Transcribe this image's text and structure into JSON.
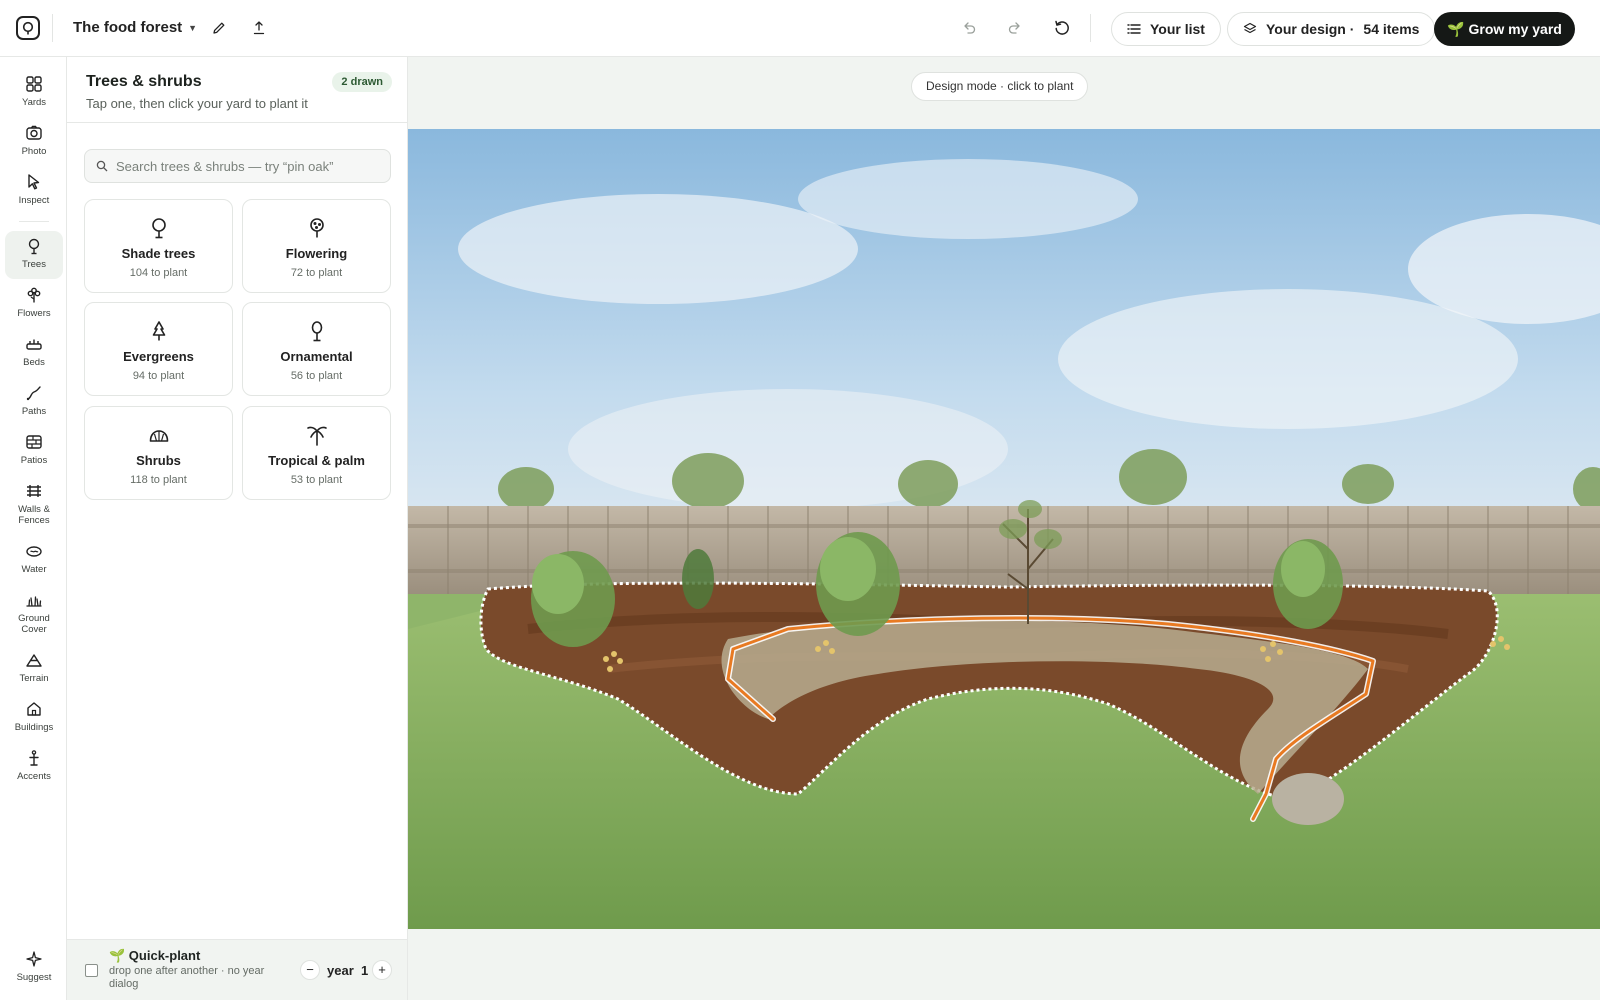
{
  "project": {
    "name": "The food forest"
  },
  "toolbar": {
    "your_list": "Your list",
    "your_design": "Your design ·",
    "design_count": "54 items",
    "grow": "🌱 Grow my yard"
  },
  "rail": {
    "items": [
      {
        "label": "Yards",
        "icon": "grid-icon"
      },
      {
        "label": "Photo",
        "icon": "camera-icon"
      },
      {
        "label": "Inspect",
        "icon": "cursor-icon"
      },
      {
        "label": "Trees",
        "icon": "tree-icon"
      },
      {
        "label": "Flowers",
        "icon": "flower-icon"
      },
      {
        "label": "Beds",
        "icon": "bed-icon"
      },
      {
        "label": "Paths",
        "icon": "path-icon"
      },
      {
        "label": "Patios",
        "icon": "patio-icon"
      },
      {
        "label": "Walls & Fences",
        "icon": "fence-icon"
      },
      {
        "label": "Water",
        "icon": "water-icon"
      },
      {
        "label": "Ground Cover",
        "icon": "grass-icon"
      },
      {
        "label": "Terrain",
        "icon": "terrain-icon"
      },
      {
        "label": "Buildings",
        "icon": "house-icon"
      },
      {
        "label": "Accents",
        "icon": "accent-icon"
      }
    ],
    "suggest": "Suggest"
  },
  "panel": {
    "title": "Trees & shrubs",
    "subtitle": "Tap one, then click your yard to plant it",
    "badge": "2 drawn",
    "search_placeholder": "Search trees & shrubs — try “pin oak”",
    "categories": [
      {
        "name": "Shade trees",
        "count": "104 to plant",
        "icon": "shade-tree-icon"
      },
      {
        "name": "Flowering",
        "count": "72 to plant",
        "icon": "flowering-tree-icon"
      },
      {
        "name": "Evergreens",
        "count": "94 to plant",
        "icon": "evergreen-icon"
      },
      {
        "name": "Ornamental",
        "count": "56 to plant",
        "icon": "ornamental-tree-icon"
      },
      {
        "name": "Shrubs",
        "count": "118 to plant",
        "icon": "shrub-icon"
      },
      {
        "name": "Tropical & palm",
        "count": "53 to plant",
        "icon": "palm-icon"
      }
    ],
    "quick_plant": {
      "title": "🌱 Quick-plant",
      "subtitle": "drop one after another · no year dialog",
      "year_label": "year",
      "year_value": "1",
      "minus": "−",
      "plus": "+"
    }
  },
  "canvas": {
    "mode": "Design mode · click to plant"
  },
  "colors": {
    "accent_dark": "#151816",
    "badge_bg": "#e9f3ea",
    "path_outline": "#e87a22",
    "active_rail": "#eef2ee"
  }
}
